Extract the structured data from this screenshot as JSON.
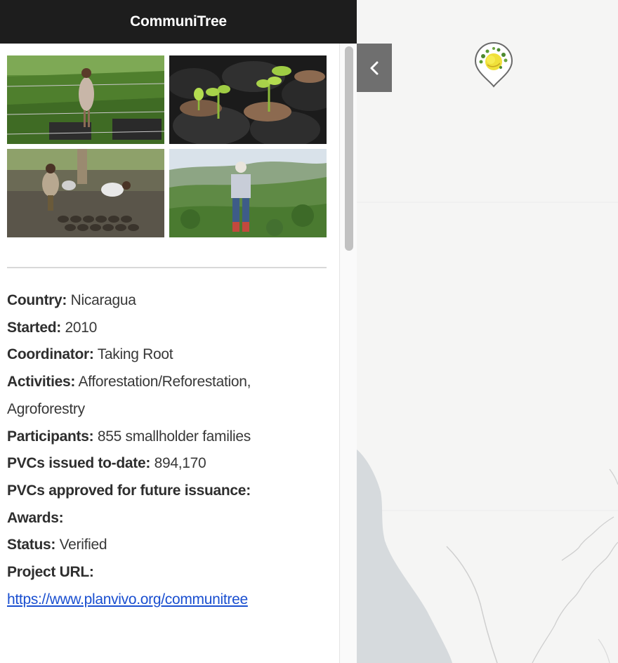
{
  "header": {
    "title": "CommuniTree"
  },
  "photos": [
    {
      "name": "woman-in-seedling-field"
    },
    {
      "name": "seedlings-in-bags"
    },
    {
      "name": "workers-in-nursery"
    },
    {
      "name": "woman-on-hillside"
    }
  ],
  "details": {
    "country_label": "Country:",
    "country": "Nicaragua",
    "started_label": "Started:",
    "started": "2010",
    "coordinator_label": "Coordinator:",
    "coordinator": "Taking Root",
    "activities_label": "Activities:",
    "activities_1": "Afforestation/Reforestation,",
    "activities_2": "Agroforestry",
    "participants_label": "Participants:",
    "participants": "855 smallholder families",
    "pvcs_issued_label": "PVCs issued to-date:",
    "pvcs_issued": "894,170",
    "pvcs_future_label": "PVCs approved for future issuance:",
    "awards_label": "Awards:",
    "status_label": "Status:",
    "status": "Verified",
    "url_label": "Project URL:",
    "url": "https://www.planvivo.org/communitree"
  },
  "map": {
    "collapse_icon": "chevron-left-icon",
    "marker_icon": "project-marker-icon",
    "colors": {
      "land": "#f5f5f4",
      "water": "#d6dadd",
      "border": "#cfcfcf"
    }
  },
  "colors": {
    "header_bg": "#1d1d1d",
    "link": "#1a4fd0",
    "collapse_bg": "#6f6f6f"
  }
}
